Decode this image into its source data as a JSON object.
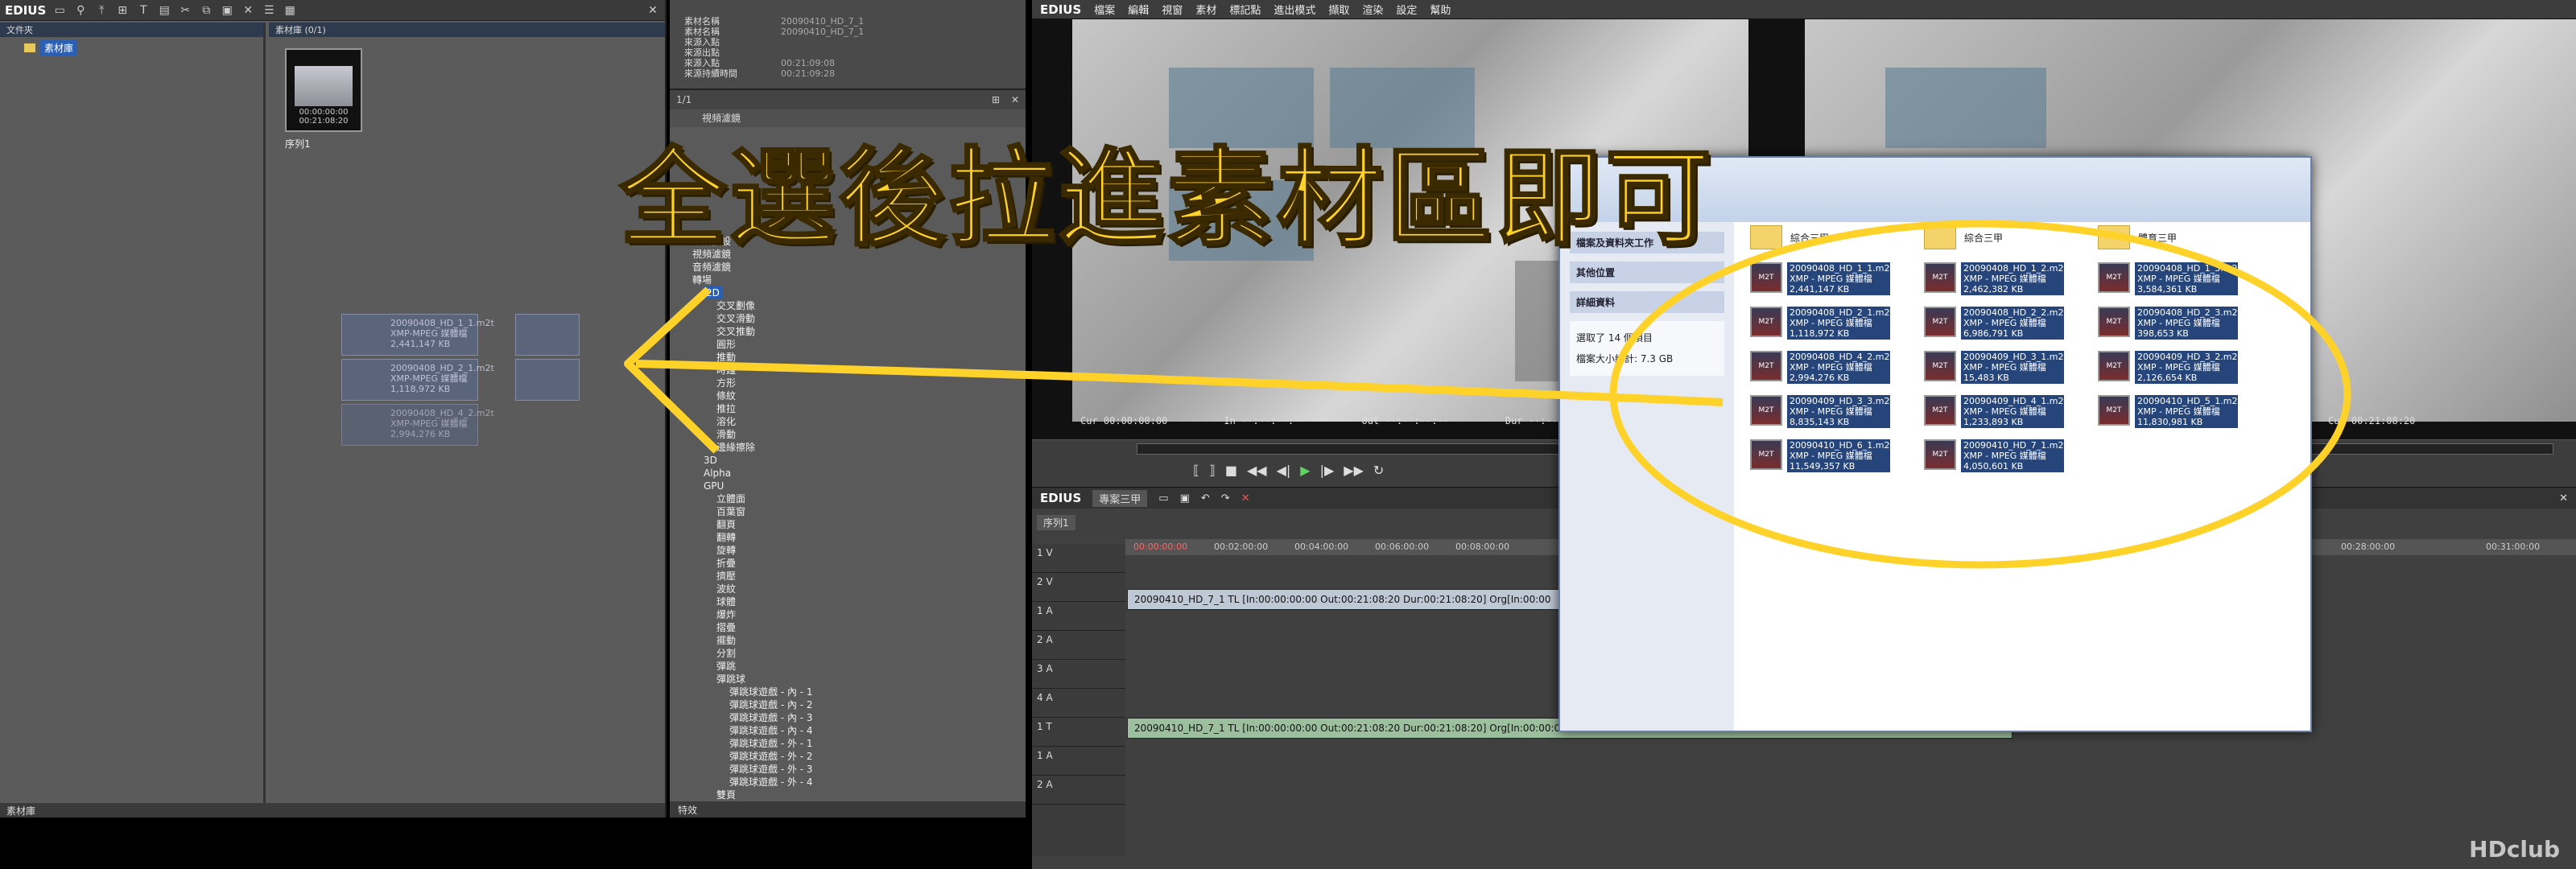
{
  "caption": "全選後拉進素材區即可",
  "watermark": "HDclub",
  "bin": {
    "brand": "EDIUS",
    "folder_header": "文件夾",
    "clip_header": "素材庫 (0/1)",
    "root_folder": "素材庫",
    "thumb_timecode": "00:00:00:00\n00:21:08:20",
    "thumb_label": "序列1",
    "status": "素材庫",
    "ghost_items": [
      "20090408_HD_1_1.m2t\nXMP-MPEG 媒體檔\n2,441,147 KB",
      "20090408_HD_2_1.m2t\nXMP-MPEG 媒體檔\n1,118,972 KB",
      "20090408_HD_4_2.m2t\nXMP-MPEG 媒體檔\n2,994,276 KB"
    ]
  },
  "props": {
    "rows": [
      {
        "k": "素材名稱",
        "v": "20090410_HD_7_1"
      },
      {
        "k": "素材名稱",
        "v": "20090410_HD_7_1"
      },
      {
        "k": "來源入點",
        "v": ""
      },
      {
        "k": "來源出點",
        "v": ""
      },
      {
        "k": "來源入點",
        "v": "00:21:09:08"
      },
      {
        "k": "來源持續時間",
        "v": "00:21:09:28"
      }
    ]
  },
  "effects": {
    "page": "1/1",
    "sub": "視頻濾鏡",
    "tree": [
      "系統預設",
      "視頻濾鏡",
      "音頻濾鏡",
      "轉場",
      "2D",
      "交叉劃像",
      "交叉滑動",
      "交叉推動",
      "圓形",
      "推動",
      "時鐘",
      "方形",
      "條紋",
      "推拉",
      "溶化",
      "滑動",
      "邊緣擦除",
      "3D",
      "Alpha",
      "GPU",
      "立體面",
      "百葉窗",
      "翻頁",
      "翻轉",
      "旋轉",
      "折疊",
      "擠壓",
      "波紋",
      "球體",
      "爆炸",
      "摺疊",
      "擺動",
      "分割",
      "彈跳",
      "彈跳球",
      "彈跳球遊戲 - 內 - 1",
      "彈跳球遊戲 - 內 - 2",
      "彈跳球遊戲 - 內 - 3",
      "彈跳球遊戲 - 內 - 4",
      "彈跳球遊戲 - 外 - 1",
      "彈跳球遊戲 - 外 - 2",
      "彈跳球遊戲 - 外 - 3",
      "彈跳球遊戲 - 外 - 4",
      "雙頁"
    ],
    "status": "特效"
  },
  "menubar": {
    "brand": "EDIUS",
    "items": [
      "檔案",
      "編輯",
      "視窗",
      "素材",
      "標記點",
      "進出模式",
      "擷取",
      "渲染",
      "設定",
      "幫助"
    ]
  },
  "preview": {
    "tc_cur": "Cur 00:00:00:00",
    "tc_in": "In --:--:--:--",
    "tc_out": "Out --:--:--:--",
    "tc_dur": "Dur --:--:--:--",
    "tc_right": "Cur 00:21:08:20"
  },
  "timeline": {
    "brand": "EDIUS",
    "project": "專案三甲",
    "seq_tab": "序列1",
    "ruler": [
      "00:00:00:00",
      "00:02:00:00",
      "00:04:00:00",
      "00:06:00:00",
      "00:08:00:00",
      "00:28:00:00",
      "00:31:00:00"
    ],
    "tracks": [
      "1 V",
      "2 V",
      "1 A",
      "2 A",
      "3 A",
      "4 A",
      "1 T",
      "1 A",
      "2 A"
    ],
    "clip1": "20090410_HD_7_1  TL [In:00:00:00:00  Out:00:21:08:20  Dur:00:21:08:20]  Org[In:00:00",
    "clip2": "20090410_HD_7_1  TL [In:00:00:00:00  Out:00:21:08:20  Dur:00:21:08:20]  Org[In:00:00:00:00"
  },
  "explorer": {
    "task1": "檔案及資料夾工作",
    "task2": "其他位置",
    "task3": "詳細資料",
    "detail1": "選取了 14 個項目",
    "detail2": "檔案大小總計: 7.3 GB",
    "folders": [
      "綜合三甲",
      "綜合三甲",
      "體育三甲"
    ],
    "files": [
      {
        "name": "20090408_HD_1_1.m2t",
        "type": "XMP - MPEG 媒體檔",
        "size": "2,441,147 KB"
      },
      {
        "name": "20090408_HD_1_2.m2t",
        "type": "XMP - MPEG 媒體檔",
        "size": "2,462,382 KB"
      },
      {
        "name": "20090408_HD_1_3.m2t",
        "type": "XMP - MPEG 媒體檔",
        "size": "3,584,361 KB"
      },
      {
        "name": "20090408_HD_2_1.m2t",
        "type": "XMP - MPEG 媒體檔",
        "size": "1,118,972 KB"
      },
      {
        "name": "20090408_HD_2_2.m2t",
        "type": "XMP - MPEG 媒體檔",
        "size": "6,986,791 KB"
      },
      {
        "name": "20090408_HD_2_3.m2t",
        "type": "XMP - MPEG 媒體檔",
        "size": "398,653 KB"
      },
      {
        "name": "20090408_HD_4_2.m2t",
        "type": "XMP - MPEG 媒體檔",
        "size": "2,994,276 KB"
      },
      {
        "name": "20090409_HD_3_1.m2t",
        "type": "XMP - MPEG 媒體檔",
        "size": "15,483 KB"
      },
      {
        "name": "20090409_HD_3_2.m2t",
        "type": "XMP - MPEG 媒體檔",
        "size": "2,126,654 KB"
      },
      {
        "name": "20090409_HD_3_3.m2t",
        "type": "XMP - MPEG 媒體檔",
        "size": "8,835,143 KB"
      },
      {
        "name": "20090409_HD_4_1.m2t",
        "type": "XMP - MPEG 媒體檔",
        "size": "1,233,893 KB"
      },
      {
        "name": "20090410_HD_5_1.m2t",
        "type": "XMP - MPEG 媒體檔",
        "size": "11,830,981 KB"
      },
      {
        "name": "20090410_HD_6_1.m2t",
        "type": "XMP - MPEG 媒體檔",
        "size": "11,549,357 KB"
      },
      {
        "name": "20090410_HD_7_1.m2t",
        "type": "XMP - MPEG 媒體檔",
        "size": "4,050,601 KB"
      }
    ]
  },
  "colors": {
    "caption": "#ffd22a",
    "selection": "#26457a",
    "highlight": "#2a5fb6"
  }
}
